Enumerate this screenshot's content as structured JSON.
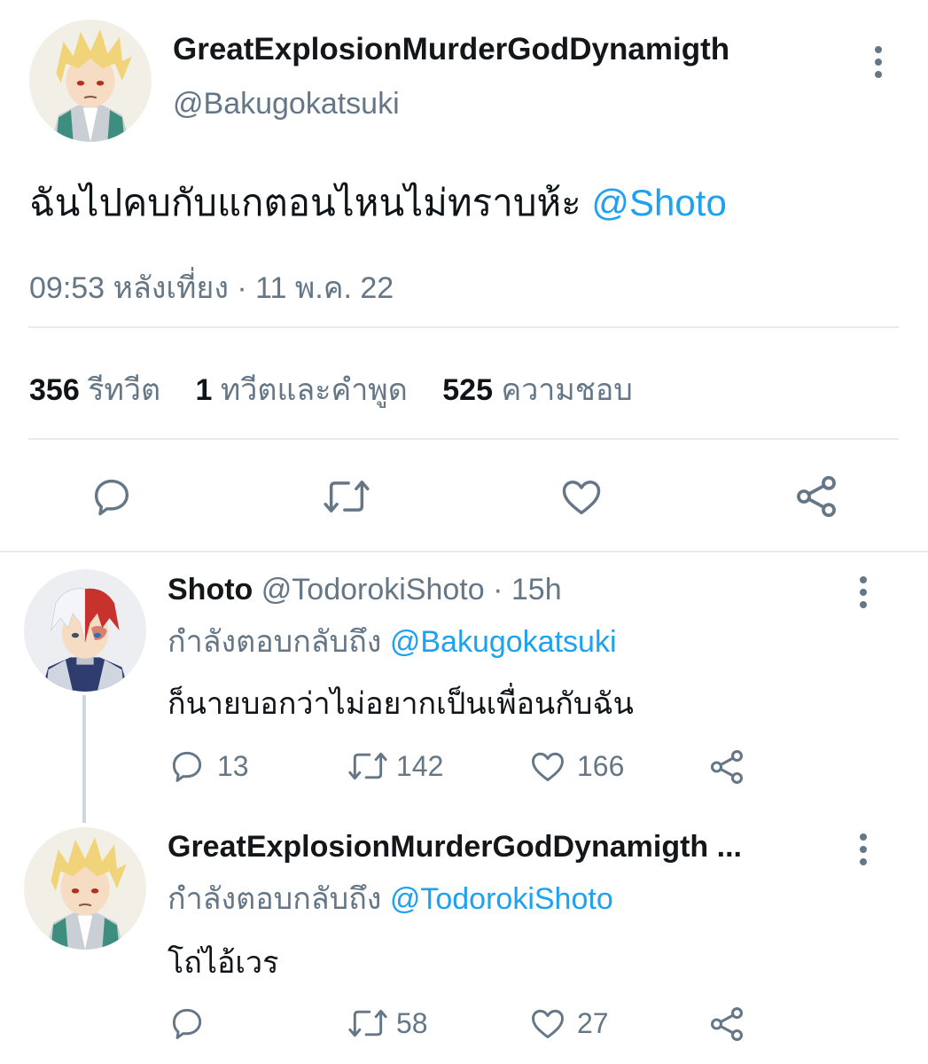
{
  "main_tweet": {
    "display_name": "GreatExplosionMurderGodDynamigth",
    "handle": "@Bakugokatsuki",
    "text": "ฉันไปคบกับแกตอนไหนไม่ทราบห้ะ",
    "mention": "@Shoto",
    "timestamp": "09:53 หลังเที่ยง · 11 พ.ค. 22",
    "stats": {
      "retweets_count": "356",
      "retweets_label": "รีทวีต",
      "quotes_count": "1",
      "quotes_label": "ทวีตและคำพูด",
      "likes_count": "525",
      "likes_label": "ความชอบ"
    }
  },
  "replies": [
    {
      "display_name": "Shoto",
      "handle": "@TodorokiShoto",
      "time": "· 15h",
      "replying_label": "กำลังตอบกลับถึง",
      "replying_to": "@Bakugokatsuki",
      "text": "ก็นายบอกว่าไม่อยากเป็นเพื่อนกับฉัน",
      "reply_count": "13",
      "retweet_count": "142",
      "like_count": "166"
    },
    {
      "display_name": "GreatExplosionMurderGodDynamigth ...",
      "replying_label": "กำลังตอบกลับถึง",
      "replying_to": "@TodorokiShoto",
      "text": "โถ่ไอ้เวร",
      "reply_count": "",
      "retweet_count": "58",
      "like_count": "27"
    }
  ],
  "colors": {
    "accent": "#1da1f2",
    "secondary_text": "#657786",
    "divider": "#e6ecf0"
  },
  "icons": [
    "more-icon",
    "reply-icon",
    "retweet-icon",
    "like-icon",
    "share-icon"
  ]
}
